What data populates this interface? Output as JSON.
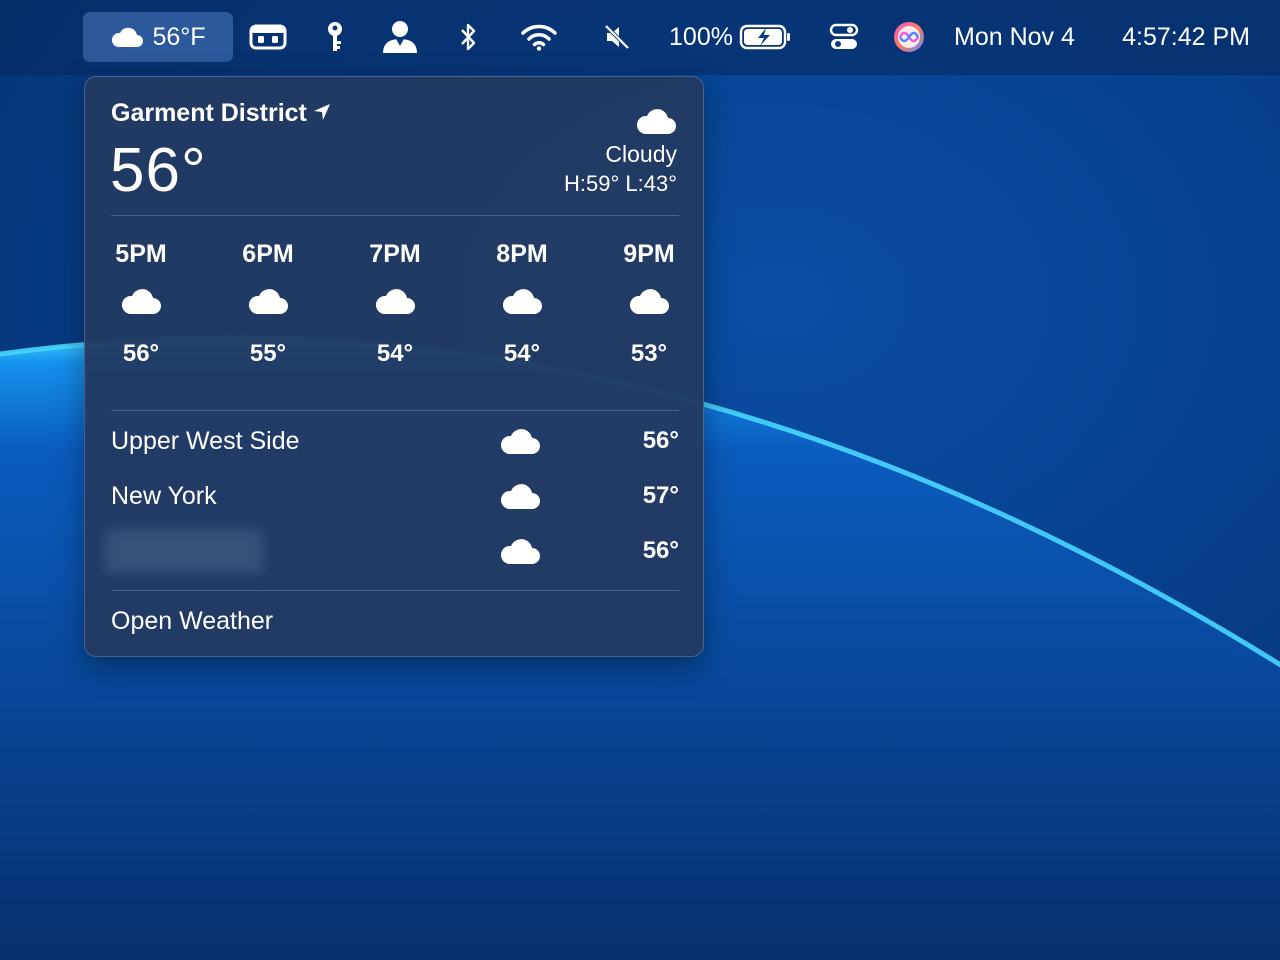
{
  "menubar": {
    "weather_temp": "56°F",
    "battery_percent": "100%",
    "date": "Mon Nov 4",
    "time": "4:57:42 PM",
    "icons": [
      "cloud-icon",
      "toolbox-icon",
      "key-icon",
      "user-icon",
      "bluetooth-icon",
      "wifi-icon",
      "mute-icon",
      "battery-icon",
      "control-center-icon",
      "siri-icon"
    ]
  },
  "weather": {
    "location": "Garment District",
    "temperature": "56°",
    "condition": "Cloudy",
    "high_low": "H:59° L:43°",
    "hourly": [
      {
        "time": "5PM",
        "temp": "56°",
        "icon": "cloud-icon"
      },
      {
        "time": "6PM",
        "temp": "55°",
        "icon": "cloud-icon"
      },
      {
        "time": "7PM",
        "temp": "54°",
        "icon": "cloud-icon"
      },
      {
        "time": "8PM",
        "temp": "54°",
        "icon": "cloud-icon"
      },
      {
        "time": "9PM",
        "temp": "53°",
        "icon": "cloud-icon"
      }
    ],
    "locations": [
      {
        "name": "Upper West Side",
        "temp": "56°",
        "icon": "cloud-icon"
      },
      {
        "name": "New York",
        "temp": "57°",
        "icon": "cloud-icon"
      },
      {
        "name": "",
        "temp": "56°",
        "icon": "cloud-icon"
      }
    ],
    "open_label": "Open Weather"
  },
  "colors": {
    "wallpaper_blue": "#07418f",
    "arc_cyan": "#22b8ff",
    "popover_bg": "#223a62"
  }
}
